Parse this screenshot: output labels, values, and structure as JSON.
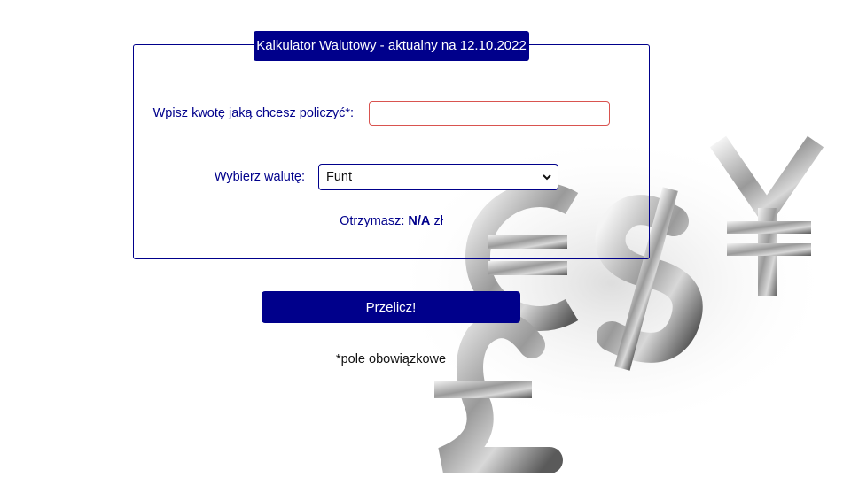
{
  "form": {
    "legend": "Kalkulator Walutowy - aktualny na 12.10.2022",
    "amount_label": "Wpisz kwotę jaką chcesz policzyć*:",
    "amount_value": "",
    "currency_label": "Wybierz walutę:",
    "currency_selected": "Funt",
    "result_prefix": "Otrzymasz:",
    "result_value": "N/A",
    "result_unit": "zł"
  },
  "button": {
    "label": "Przelicz!"
  },
  "note": "*pole obowiązkowe",
  "colors": {
    "primary": "#00008b",
    "input_border_error": "#d9534f",
    "background": "#ffffff"
  },
  "icons": {
    "background": "currency-symbols-illustration",
    "select_arrow": "chevron-down-icon"
  }
}
